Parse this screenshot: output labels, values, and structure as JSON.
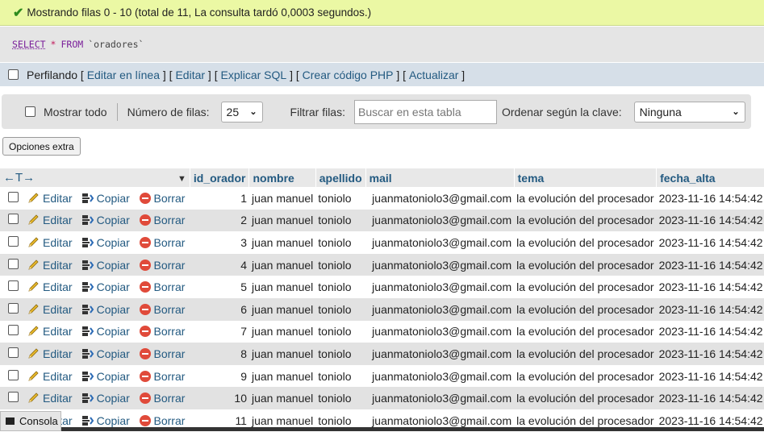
{
  "success": {
    "message": "Mostrando filas 0 - 10 (total de 11, La consulta tardó 0,0003 segundos.)"
  },
  "sql": {
    "select": "SELECT",
    "star": "*",
    "from": "FROM",
    "table": "`oradores`"
  },
  "profiling": {
    "label": "Perfilando",
    "links": [
      "Editar en línea",
      "Editar",
      "Explicar SQL",
      "Crear código PHP",
      "Actualizar"
    ]
  },
  "nav": {
    "show_all": "Mostrar todo",
    "rows_label": "Número de filas:",
    "rows_value": "25",
    "filter_label": "Filtrar filas:",
    "filter_placeholder": "Buscar en esta tabla",
    "sort_label": "Ordenar según la clave:",
    "sort_value": "Ninguna"
  },
  "extra_options": "Opciones extra",
  "table": {
    "columns": [
      "id_orador",
      "nombre",
      "apellido",
      "mail",
      "tema",
      "fecha_alta"
    ],
    "actions": {
      "edit": "Editar",
      "copy": "Copiar",
      "delete": "Borrar"
    },
    "rows": [
      [
        "1",
        "juan manuel",
        "toniolo",
        "juanmatoniolo3@gmail.com",
        "la evolución del procesador",
        "2023-11-16 14:54:42"
      ],
      [
        "2",
        "juan manuel",
        "toniolo",
        "juanmatoniolo3@gmail.com",
        "la evolución del procesador",
        "2023-11-16 14:54:42"
      ],
      [
        "3",
        "juan manuel",
        "toniolo",
        "juanmatoniolo3@gmail.com",
        "la evolución del procesador",
        "2023-11-16 14:54:42"
      ],
      [
        "4",
        "juan manuel",
        "toniolo",
        "juanmatoniolo3@gmail.com",
        "la evolución del procesador",
        "2023-11-16 14:54:42"
      ],
      [
        "5",
        "juan manuel",
        "toniolo",
        "juanmatoniolo3@gmail.com",
        "la evolución del procesador",
        "2023-11-16 14:54:42"
      ],
      [
        "6",
        "juan manuel",
        "toniolo",
        "juanmatoniolo3@gmail.com",
        "la evolución del procesador",
        "2023-11-16 14:54:42"
      ],
      [
        "7",
        "juan manuel",
        "toniolo",
        "juanmatoniolo3@gmail.com",
        "la evolución del procesador",
        "2023-11-16 14:54:42"
      ],
      [
        "8",
        "juan manuel",
        "toniolo",
        "juanmatoniolo3@gmail.com",
        "la evolución del procesador",
        "2023-11-16 14:54:42"
      ],
      [
        "9",
        "juan manuel",
        "toniolo",
        "juanmatoniolo3@gmail.com",
        "la evolución del procesador",
        "2023-11-16 14:54:42"
      ],
      [
        "10",
        "juan manuel",
        "toniolo",
        "juanmatoniolo3@gmail.com",
        "la evolución del procesador",
        "2023-11-16 14:54:42"
      ],
      [
        "11",
        "juan manuel",
        "toniolo",
        "juanmatoniolo3@gmail.com",
        "la evolución del procesador",
        "2023-11-16 14:54:42"
      ]
    ]
  },
  "console": {
    "label": "Consola"
  },
  "colors": {
    "success_bg": "#ebf8a4",
    "link": "#235a81",
    "stripe": "#e2e2e2",
    "delete": "#e04a3a"
  }
}
